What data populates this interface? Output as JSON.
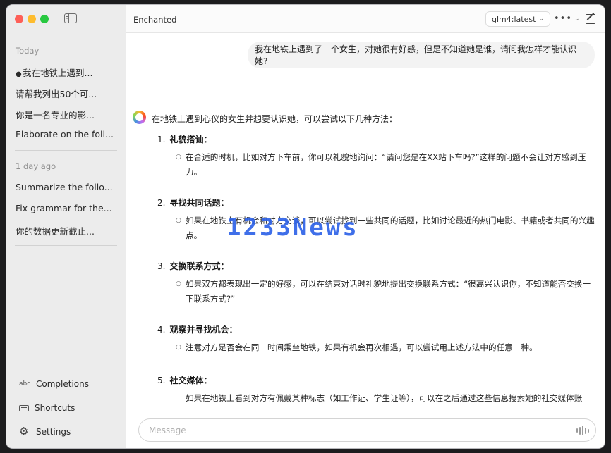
{
  "sidebar": {
    "sections": [
      {
        "label": "Today",
        "items": [
          {
            "label": "我在地铁上遇到...",
            "active": true
          },
          {
            "label": "请帮我列出50个可..."
          },
          {
            "label": "你是一名专业的影..."
          },
          {
            "label": "Elaborate on the foll..."
          }
        ]
      },
      {
        "label": "1 day ago",
        "items": [
          {
            "label": "Summarize the follo..."
          },
          {
            "label": "Fix grammar for the..."
          },
          {
            "label": "你的数据更新截止..."
          }
        ]
      }
    ],
    "bottom": {
      "completions_icon": "abc",
      "completions": "Completions",
      "shortcuts": "Shortcuts",
      "settings": "Settings"
    }
  },
  "header": {
    "title": "Enchanted",
    "model": "glm4:latest",
    "more": "•••"
  },
  "conversation": {
    "user_message": "我在地铁上遇到了一个女生，对她很有好感，但是不知道她是谁，请问我怎样才能认识她?",
    "assistant_intro": "在地铁上遇到心仪的女生并想要认识她，可以尝试以下几种方法：",
    "steps": [
      {
        "num": "1.",
        "title": "礼貌搭讪：",
        "body": "在合适的时机，比如对方下车前，你可以礼貌地询问：“请问您是在XX站下车吗?”这样的问题不会让对方感到压力。"
      },
      {
        "num": "2.",
        "title": "寻找共同话题：",
        "body": "如果在地铁上有机会和对方交谈，可以尝试找到一些共同的话题，比如讨论最近的热门电影、书籍或者共同的兴趣点。"
      },
      {
        "num": "3.",
        "title": "交换联系方式：",
        "body": "如果双方都表现出一定的好感，可以在结束对话时礼貌地提出交换联系方式：“很高兴认识你，不知道能否交换一下联系方式?”"
      },
      {
        "num": "4.",
        "title": "观察并寻找机会：",
        "body": "注意对方是否会在同一时间乘坐地铁，如果有机会再次相遇，可以尝试用上述方法中的任意一种。"
      },
      {
        "num": "5.",
        "title": "社交媒体：",
        "body": "如果在地铁上看到对方有佩戴某种标志（如工作证、学生证等），可以在之后通过这些信息搜索她的社交媒体账"
      }
    ]
  },
  "watermark": "1233News",
  "input": {
    "placeholder": "Message",
    "value": ""
  }
}
